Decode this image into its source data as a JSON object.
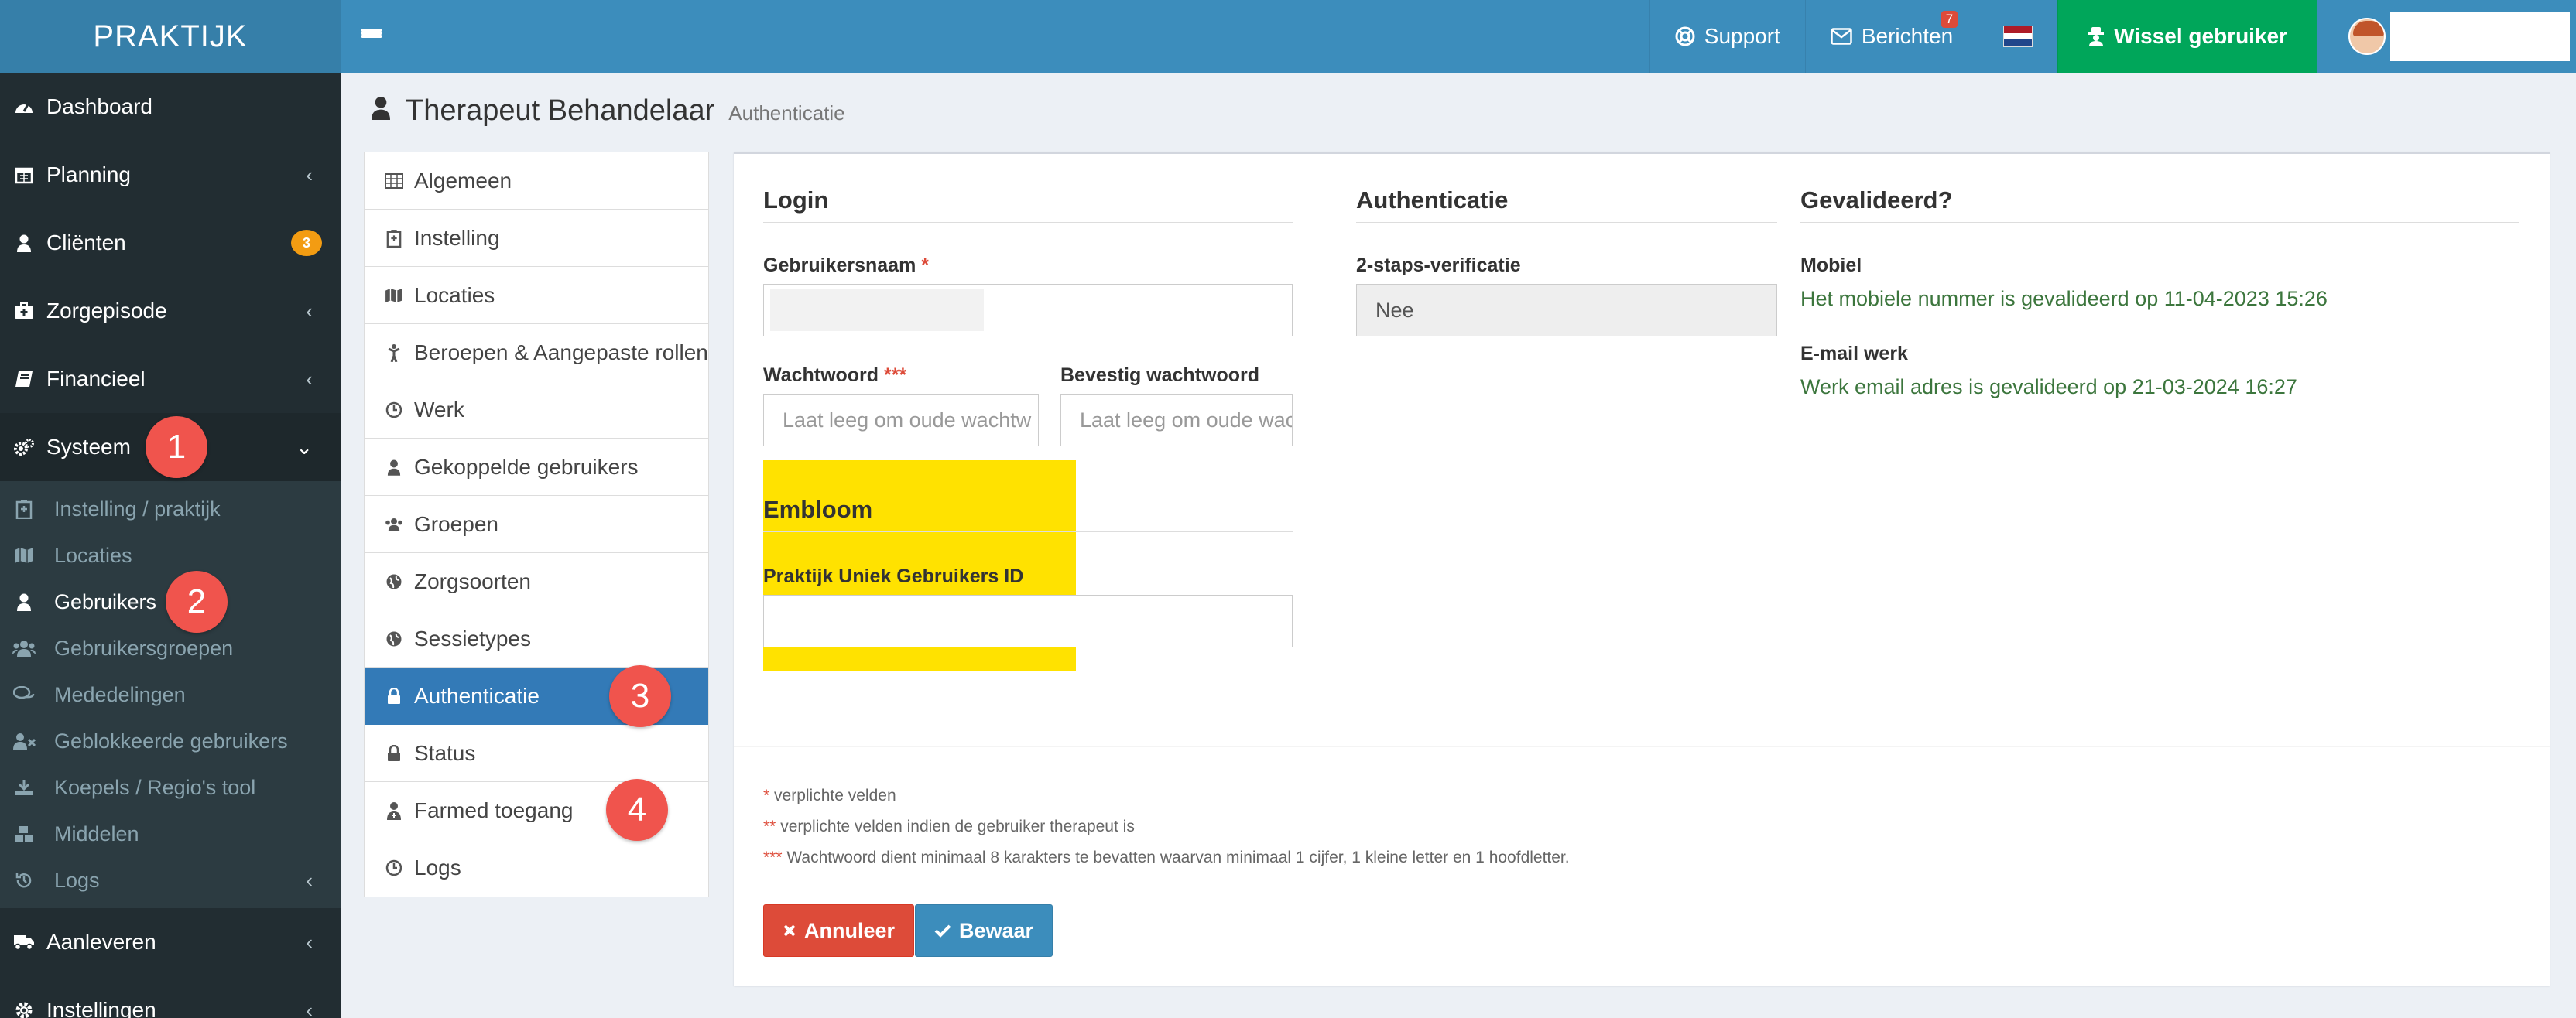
{
  "brand": "PRAKTIJK",
  "topbar": {
    "support": "Support",
    "messages": "Berichten",
    "messages_count": "7",
    "switch_user": "Wissel gebruiker"
  },
  "sidebar": {
    "dashboard": "Dashboard",
    "planning": "Planning",
    "clients": "Cliënten",
    "clients_badge": "3",
    "zorgepisode": "Zorgepisode",
    "financieel": "Financieel",
    "systeem": "Systeem",
    "sub": {
      "instelling": "Instelling / praktijk",
      "locaties": "Locaties",
      "gebruikers": "Gebruikers",
      "gebruikersgroepen": "Gebruikersgroepen",
      "mededelingen": "Mededelingen",
      "geblokkeerde": "Geblokkeerde gebruikers",
      "koepels": "Koepels / Regio's tool",
      "middelen": "Middelen",
      "logs": "Logs"
    },
    "aanleveren": "Aanleveren",
    "instellingen": "Instellingen"
  },
  "markers": {
    "m1": "1",
    "m2": "2",
    "m3": "3",
    "m4": "4"
  },
  "header": {
    "title": "Therapeut Behandelaar",
    "subtitle": "Authenticatie"
  },
  "tabs": {
    "algemeen": "Algemeen",
    "instelling": "Instelling",
    "locaties": "Locaties",
    "beroepen": "Beroepen & Aangepaste rollen",
    "werk": "Werk",
    "gekoppelde": "Gekoppelde gebruikers",
    "groepen": "Groepen",
    "zorgsoorten": "Zorgsoorten",
    "sessietypes": "Sessietypes",
    "authenticatie": "Authenticatie",
    "status": "Status",
    "farmed": "Farmed toegang",
    "logs": "Logs"
  },
  "form": {
    "login_title": "Login",
    "username_label": "Gebruikersnaam",
    "req1": "*",
    "password_label": "Wachtwoord",
    "req3": "***",
    "password_placeholder": "Laat leeg om oude wachtw",
    "confirm_label": "Bevestig wachtwoord",
    "confirm_placeholder": "Laat leeg om oude wachtw",
    "embloom_title": "Embloom",
    "embloom_label": "Praktijk Uniek Gebruikers ID",
    "auth_title": "Authenticatie",
    "twofa_label": "2-staps-verificatie",
    "twofa_value": "Nee",
    "validated_title": "Gevalideerd?",
    "mobile_label": "Mobiel",
    "mobile_text": "Het mobiele nummer is gevalideerd op 11-04-2023 15:26",
    "email_label": "E-mail werk",
    "email_text": "Werk email adres is gevalideerd op 21-03-2024 16:27"
  },
  "notes": {
    "n1_mark": "*",
    "n1": "verplichte velden",
    "n2_mark": "**",
    "n2": "verplichte velden indien de gebruiker therapeut is",
    "n3_mark": "***",
    "n3": "Wachtwoord dient minimaal 8 karakters te bevatten waarvan minimaal 1 cijfer, 1 kleine letter en 1 hoofdletter."
  },
  "buttons": {
    "cancel": "Annuleer",
    "save": "Bewaar"
  },
  "colors": {
    "topbar": "#3c8dbc",
    "brand": "#367fa9",
    "sidebar": "#222d32",
    "switch": "#00a65a",
    "active_tab": "#337ab7",
    "marker": "#f0544d",
    "highlight": "#ffe200"
  }
}
